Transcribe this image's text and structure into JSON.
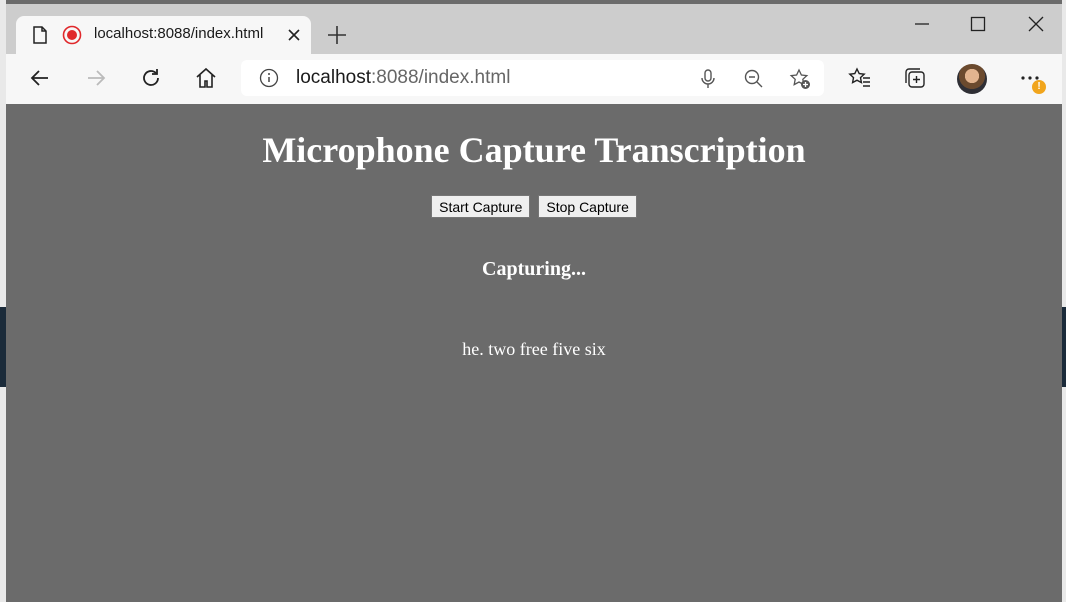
{
  "browser": {
    "tab_title": "localhost:8088/index.html",
    "url_host": "localhost",
    "url_rest": ":8088/index.html"
  },
  "icons": {
    "tab": [
      "page-icon",
      "recording-icon",
      "close-icon"
    ],
    "window": [
      "minimize-icon",
      "maximize-icon",
      "close-window-icon"
    ],
    "toolbar": [
      "back-icon",
      "forward-icon",
      "refresh-icon",
      "home-icon",
      "info-icon",
      "microphone-icon",
      "zoom-out-icon",
      "add-favorite-icon",
      "favorites-icon",
      "collections-icon",
      "profile-avatar",
      "more-icon"
    ]
  },
  "alert_badge": "!",
  "page": {
    "heading": "Microphone Capture Transcription",
    "start_button": "Start Capture",
    "stop_button": "Stop Capture",
    "status": "Capturing...",
    "transcript": "he. two free five six"
  },
  "colors": {
    "page_bg": "#6b6b6b",
    "recording_red": "#e0282b",
    "alert_orange": "#f1a51c"
  }
}
